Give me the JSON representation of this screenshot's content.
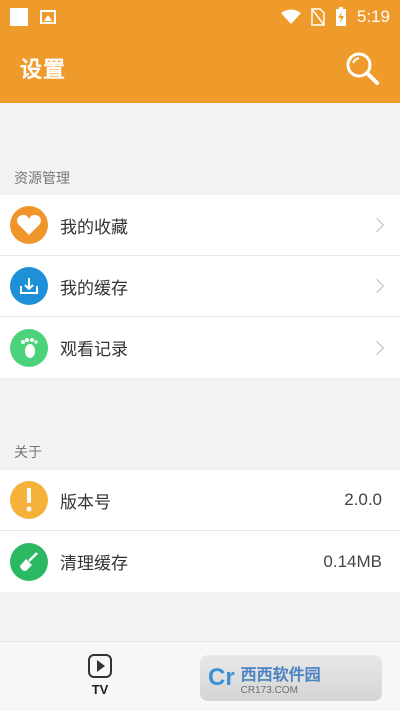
{
  "status_bar": {
    "time": "5:19",
    "icons": [
      "notification-square-icon",
      "image-icon",
      "wifi-icon",
      "no-sim-icon",
      "battery-charging-icon"
    ]
  },
  "app_bar": {
    "title": "设置",
    "search_icon": "search-icon"
  },
  "sections": [
    {
      "label": "资源管理",
      "items": [
        {
          "label": "我的收藏",
          "icon": "heart-icon",
          "color": "#f0952a"
        },
        {
          "label": "我的缓存",
          "icon": "download-icon",
          "color": "#1e90d8"
        },
        {
          "label": "观看记录",
          "icon": "footprint-icon",
          "color": "#4cd27a"
        }
      ]
    },
    {
      "label": "关于",
      "items": [
        {
          "label": "版本号",
          "value": "2.0.0",
          "icon": "info-icon",
          "color": "#f6b13a"
        },
        {
          "label": "清理缓存",
          "value": "0.14MB",
          "icon": "broom-icon",
          "color": "#2bb862"
        }
      ]
    }
  ],
  "bottom_nav": {
    "tab_label": "TV",
    "tab_icon": "tv-play-icon"
  },
  "watermark": {
    "logo": "Cr",
    "brand": "西西软件园",
    "url": "CR173.COM"
  },
  "colors": {
    "accent": "#ef9b2c",
    "background": "#f2f2f2"
  }
}
